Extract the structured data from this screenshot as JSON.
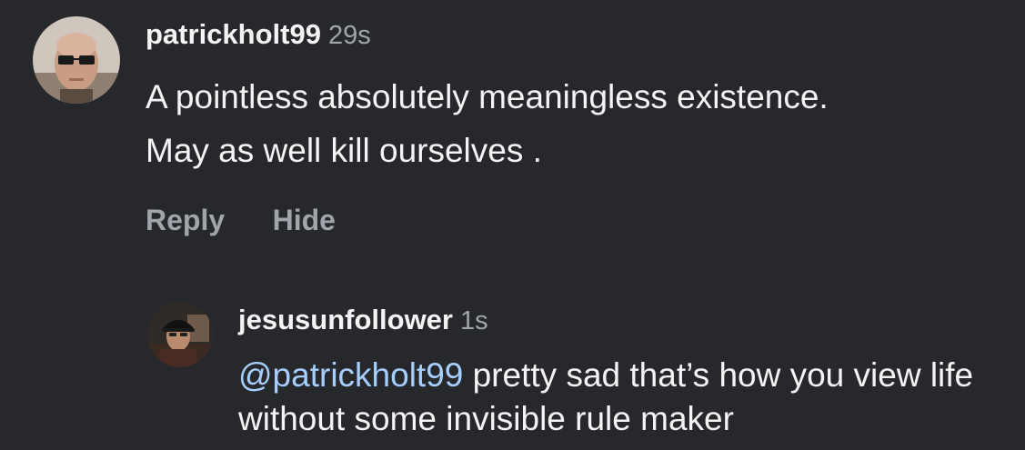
{
  "comments": [
    {
      "username": "patrickholt99",
      "time": "29s",
      "text": [
        "A pointless absolutely meaningless existence.",
        "May as well kill ourselves ."
      ],
      "actions": [
        "Reply",
        "Hide"
      ]
    }
  ],
  "reply": {
    "username": "jesusunfollower",
    "time": "1s",
    "mention": "@patrickholt99",
    "text": "pretty sad that’s how you view life without some invisible rule maker"
  },
  "colors": {
    "background": "#26282c",
    "primary_text": "#f4f4f5",
    "secondary_text": "#a1a4ab",
    "mention": "#a6ceff"
  }
}
